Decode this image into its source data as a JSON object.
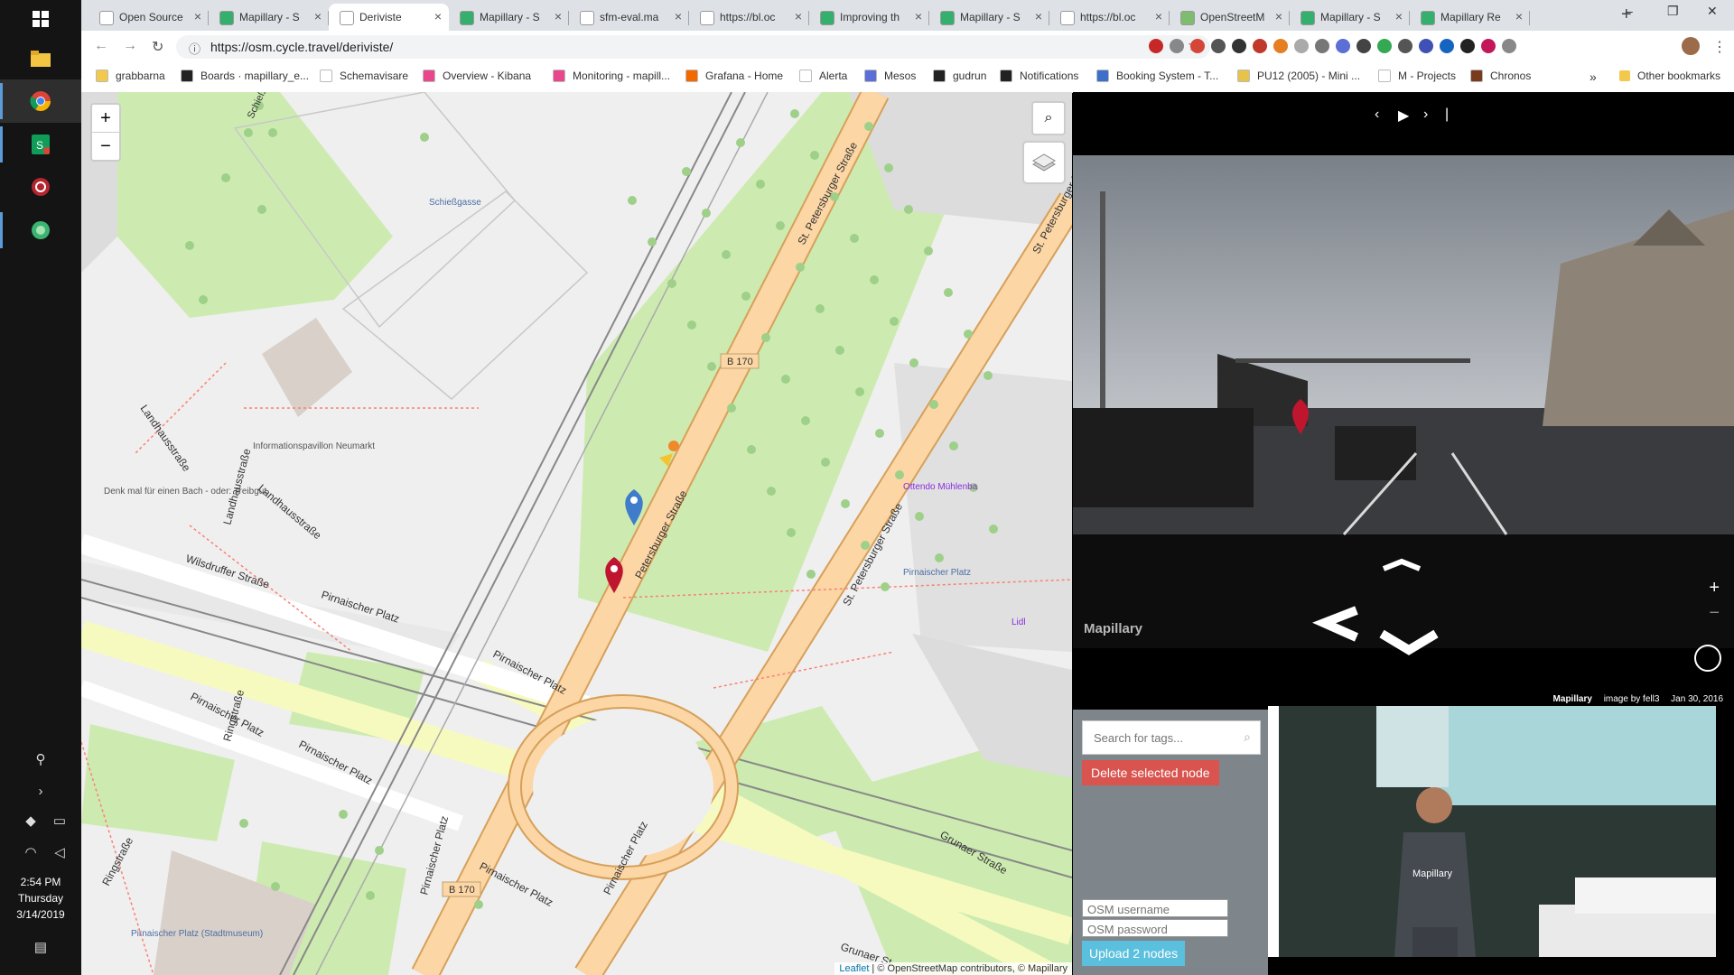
{
  "browser": {
    "tabs": [
      {
        "title": "Open Source",
        "icon": "page-icon",
        "color": "#ffffff"
      },
      {
        "title": "Mapillary - S",
        "icon": "mapillary-icon",
        "color": "#35af6d"
      },
      {
        "title": "Deriviste",
        "icon": "page-icon",
        "color": "#ffffff",
        "active": true
      },
      {
        "title": "Mapillary - S",
        "icon": "mapillary-icon",
        "color": "#35af6d"
      },
      {
        "title": "sfm-eval.ma",
        "icon": "page-icon",
        "color": "#ffffff"
      },
      {
        "title": "https://bl.oc",
        "icon": "page-icon",
        "color": "#ffffff"
      },
      {
        "title": "Improving th",
        "icon": "mapillary-icon",
        "color": "#35af6d"
      },
      {
        "title": "Mapillary - S",
        "icon": "mapillary-icon",
        "color": "#35af6d"
      },
      {
        "title": "https://bl.oc",
        "icon": "page-icon",
        "color": "#ffffff"
      },
      {
        "title": "OpenStreetM",
        "icon": "osm-icon",
        "color": "#7ebc6f"
      },
      {
        "title": "Mapillary - S",
        "icon": "mapillary-icon",
        "color": "#35af6d"
      },
      {
        "title": "Mapillary Re",
        "icon": "mapillary-icon",
        "color": "#35af6d"
      }
    ],
    "url": "https://osm.cycle.travel/deriviste/",
    "bookmarks": [
      {
        "label": "grabbarna",
        "icon": "folder-icon",
        "color": "#f2c94c"
      },
      {
        "label": "Boards · mapillary_e...",
        "icon": "github-icon",
        "color": "#222222"
      },
      {
        "label": "Schemavisare",
        "icon": "page-icon",
        "color": "#ffffff"
      },
      {
        "label": "Overview - Kibana",
        "icon": "kibana-icon",
        "color": "#e8478b"
      },
      {
        "label": "Monitoring - mapill...",
        "icon": "kibana-icon",
        "color": "#e8478b"
      },
      {
        "label": "Grafana - Home",
        "icon": "grafana-icon",
        "color": "#f46800"
      },
      {
        "label": "Alerta",
        "icon": "page-icon",
        "color": "#ffffff"
      },
      {
        "label": "Mesos",
        "icon": "mesos-icon",
        "color": "#5b6fd6"
      },
      {
        "label": "gudrun",
        "icon": "r-icon",
        "color": "#222222"
      },
      {
        "label": "Notifications",
        "icon": "github-icon",
        "color": "#222222"
      },
      {
        "label": "Booking System - T...",
        "icon": "booking-icon",
        "color": "#3b6fc9"
      },
      {
        "label": "PU12 (2005) - Mini ...",
        "icon": "pu-icon",
        "color": "#e7c34c"
      },
      {
        "label": "M - Projects",
        "icon": "page-icon",
        "color": "#ffffff"
      },
      {
        "label": "Chronos",
        "icon": "chronos-icon",
        "color": "#7a3a1e"
      }
    ],
    "more_bookmarks": "»",
    "other_bookmarks": "Other bookmarks"
  },
  "taskbar": {
    "time": "2:54 PM",
    "day": "Thursday",
    "date": "3/14/2019"
  },
  "map": {
    "zoom_in": "+",
    "zoom_out": "−",
    "labels": {
      "st_petersburger_1": "St. Petersburger Straße",
      "st_petersburger_2": "St. Petersburger Straße",
      "st_petersburger_3": "St. Petersburger Straße",
      "petersburger_partial": "Petersburger Straße",
      "b170_top": "B 170",
      "b170_bottom": "B 170",
      "wilsdruffer": "Wilsdruffer Straße",
      "pirnaischer_1": "Pirnaischer Platz",
      "pirnaischer_2": "Pirnaischer Platz",
      "pirnaischer_3": "Pirnaischer Platz",
      "pirnaischer_4": "Pirnaischer Platz",
      "pirnaischer_5": "Pirnaischer Platz",
      "pirnaischer_6": "Pirnaischer Platz",
      "pirnaischer_7": "Pirnaischer Platz",
      "pirnaischer_stop": "Pirnaischer Platz",
      "landhaus_1": "Landhausstraße",
      "landhaus_2": "Landhausstraße",
      "landhaus_3": "Landhausstraße",
      "ringstrasse_1": "Ringstraße",
      "ringstrasse_2": "Ringstraße",
      "grunaer_1": "Grunaer Straße",
      "grunaer_2": "Grunaer St",
      "schiessgasse": "Schießgasse",
      "schiessgasse_2": "Schießg",
      "infopavillon": "Informationspavillon Neumarkt",
      "denkmal": "Denk mal für einen Bach - oder: Treibgut",
      "stadtmuseum": "Pirnaischer Platz (Stadtmuseum)",
      "ottendorfer": "Ottendo Mühlenba",
      "lidl": "Lidl"
    },
    "attribution": {
      "leaflet": "Leaflet",
      "osm": "© OpenStreetMap contributors",
      "mapillary": "© Mapillary"
    }
  },
  "viewer": {
    "brand": "Mapillary",
    "image_credit": "image by fell3",
    "image_date": "Jan 30, 2016",
    "zoom_in": "+",
    "zoom_out": "−"
  },
  "panel": {
    "search_placeholder": "Search for tags...",
    "delete_label": "Delete selected node",
    "username_placeholder": "OSM username",
    "password_placeholder": "OSM password",
    "upload_label": "Upload 2 nodes"
  },
  "video": {
    "shirt_text": "Mapillary"
  }
}
